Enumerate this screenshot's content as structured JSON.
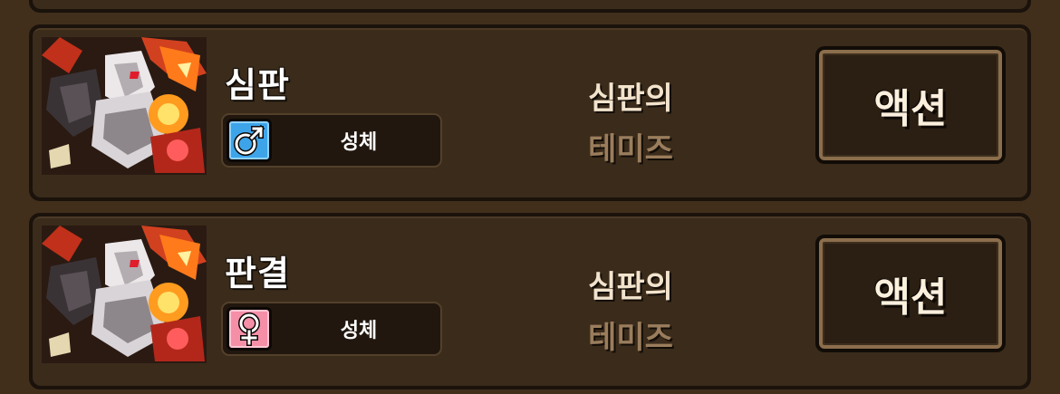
{
  "action_label": "액션",
  "colors": {
    "male": "#3da4ea",
    "female": "#f58fa8",
    "title_highlight": "#f2e3cd",
    "title_dim": "#9a7d5c"
  },
  "entries": [
    {
      "name": "심판",
      "gender": "male",
      "gender_icon": "male-symbol-icon",
      "species": "성체",
      "title_line1": "심판의",
      "title_line2": "테미즈",
      "portrait": "dragon-portrait"
    },
    {
      "name": "판결",
      "gender": "female",
      "gender_icon": "female-symbol-icon",
      "species": "성체",
      "title_line1": "심판의",
      "title_line2": "테미즈",
      "portrait": "dragon-portrait"
    }
  ]
}
